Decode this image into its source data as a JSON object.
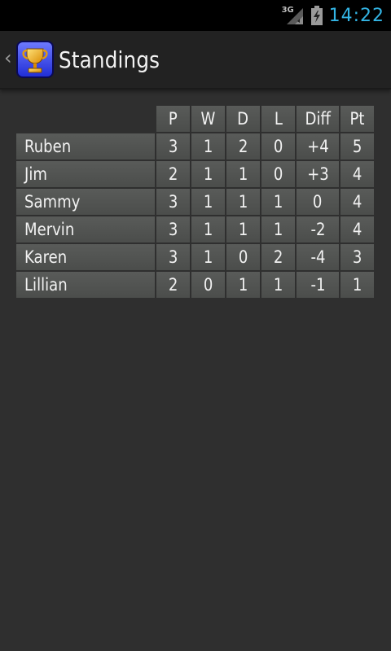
{
  "status_bar": {
    "network": "3G",
    "time": "14:22",
    "clock_color": "#33b5e5"
  },
  "action_bar": {
    "title": "Standings",
    "up_icon": "back-caret-icon",
    "app_icon": "trophy-icon"
  },
  "standings": {
    "columns": [
      "P",
      "W",
      "D",
      "L",
      "Diff",
      "Pt"
    ],
    "rows": [
      {
        "name": "Ruben",
        "p": "3",
        "w": "1",
        "d": "2",
        "l": "0",
        "diff": "+4",
        "pt": "5"
      },
      {
        "name": "Jim",
        "p": "2",
        "w": "1",
        "d": "1",
        "l": "0",
        "diff": "+3",
        "pt": "4"
      },
      {
        "name": "Sammy",
        "p": "3",
        "w": "1",
        "d": "1",
        "l": "1",
        "diff": "0",
        "pt": "4"
      },
      {
        "name": "Mervin",
        "p": "3",
        "w": "1",
        "d": "1",
        "l": "1",
        "diff": "-2",
        "pt": "4"
      },
      {
        "name": "Karen",
        "p": "3",
        "w": "1",
        "d": "0",
        "l": "2",
        "diff": "-4",
        "pt": "3"
      },
      {
        "name": "Lillian",
        "p": "2",
        "w": "0",
        "d": "1",
        "l": "1",
        "diff": "-1",
        "pt": "1"
      }
    ]
  }
}
